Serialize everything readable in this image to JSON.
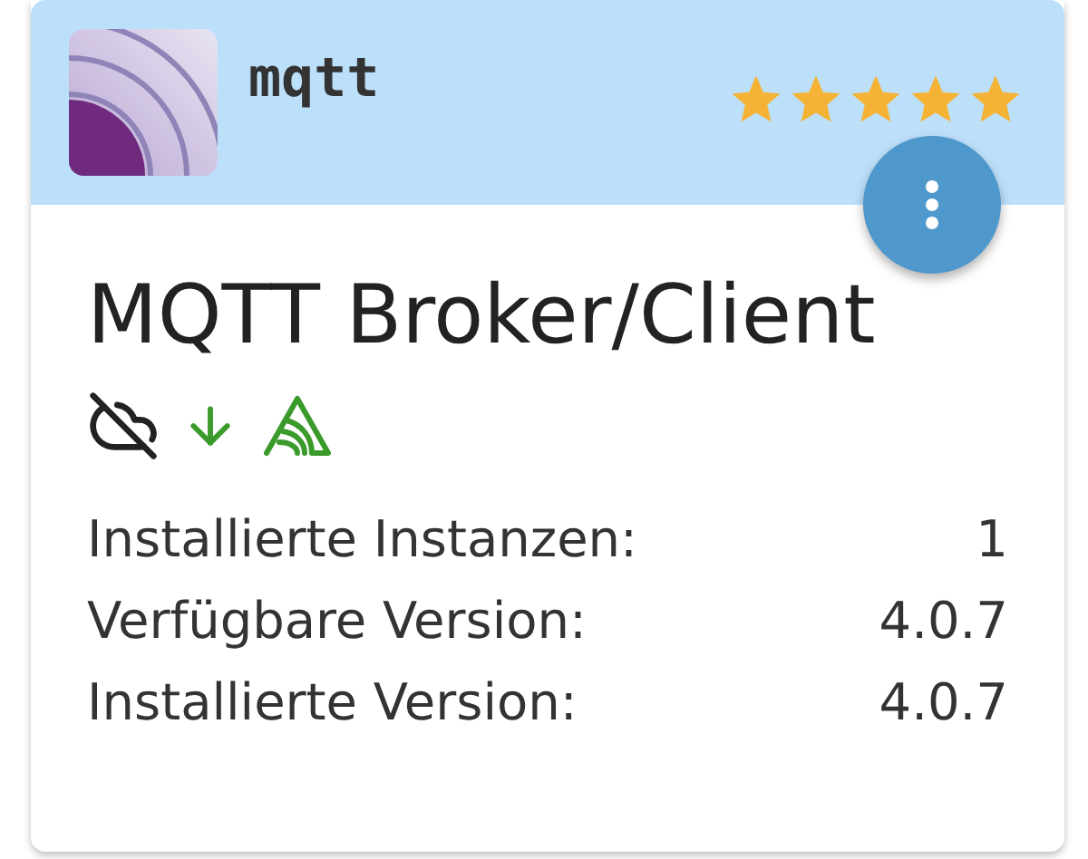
{
  "adapter": {
    "name": "mqtt",
    "stars": 5,
    "title": "MQTT Broker/Client"
  },
  "info": [
    {
      "label": "Installierte Instanzen:",
      "value": "1"
    },
    {
      "label": "Verfügbare Version:",
      "value": "4.0.7"
    },
    {
      "label": "Installierte Version:",
      "value": "4.0.7"
    }
  ]
}
